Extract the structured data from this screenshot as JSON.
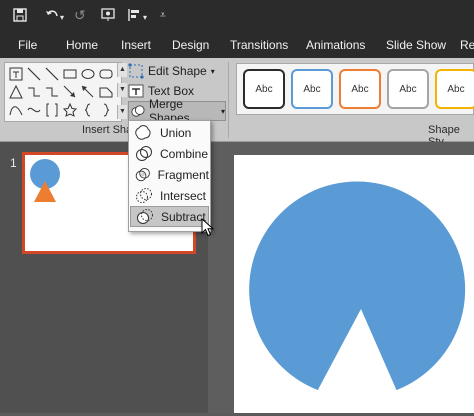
{
  "quick_access": {
    "save_icon": "save-icon",
    "undo_icon": "undo-icon",
    "redo_icon": "redo-icon",
    "from_beginning_icon": "present-icon",
    "customize_icon": "customize-icon"
  },
  "tabs": [
    "File",
    "Home",
    "Insert",
    "Design",
    "Transitions",
    "Animations",
    "Slide Show",
    "Re"
  ],
  "ribbon": {
    "edit_shape": "Edit Shape",
    "text_box": "Text Box",
    "merge_shapes": "Merge Shapes",
    "insert_shapes_label": "Insert Sha",
    "shape_styles_label": "Shape Sty",
    "style_swatches": [
      {
        "text": "Abc",
        "border": "#2b2b2b"
      },
      {
        "text": "Abc",
        "border": "#5b9bd5"
      },
      {
        "text": "Abc",
        "border": "#ed7d31"
      },
      {
        "text": "Abc",
        "border": "#a5a5a5"
      },
      {
        "text": "Abc",
        "border": "#f2b400"
      }
    ]
  },
  "merge_menu": {
    "items": [
      {
        "label": "Union",
        "icon": "union-icon"
      },
      {
        "label": "Combine",
        "icon": "combine-icon"
      },
      {
        "label": "Fragment",
        "icon": "fragment-icon"
      },
      {
        "label": "Intersect",
        "icon": "intersect-icon"
      },
      {
        "label": "Subtract",
        "icon": "subtract-icon"
      }
    ],
    "highlighted": "Subtract"
  },
  "slides_panel": {
    "slide_number": "1"
  },
  "colors": {
    "circle": "#5b9bd5",
    "triangle": "#ed7d31",
    "thumb_border": "#d24726",
    "ribbon_bg": "#c8c8c8",
    "title_bar": "#2b2b2b"
  }
}
